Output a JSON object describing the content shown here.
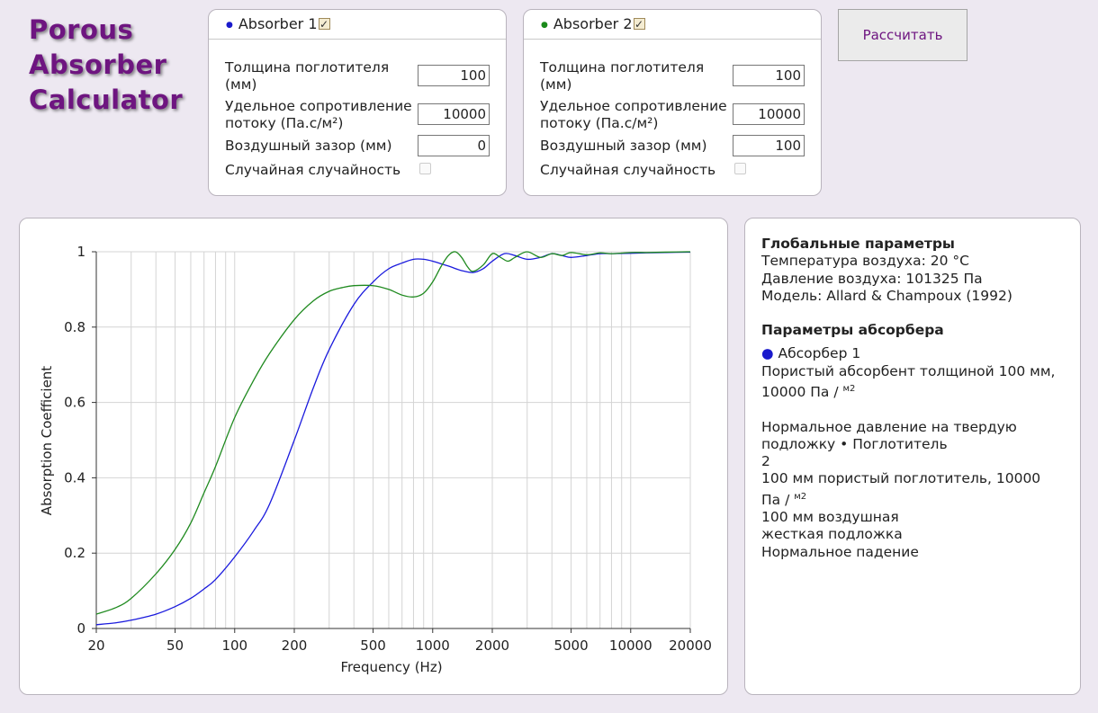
{
  "logo": {
    "line1": "Porous",
    "line2": "Absorber",
    "line3": "Calculator"
  },
  "absorbers": [
    {
      "title": "Absorber 1",
      "enabled": true,
      "dot_color": "#1a1acc",
      "fields": {
        "thickness_label_1": "Толщина поглотителя",
        "thickness_label_2": "(мм)",
        "thickness": "100",
        "resistivity_label_1": "Удельное сопротивление",
        "resistivity_label_2": "потоку (Па.с/м²)",
        "resistivity": "10000",
        "airgap_label": "Воздушный зазор (мм)",
        "airgap": "0",
        "random_label": "Случайная случайность",
        "random": false
      }
    },
    {
      "title": "Absorber 2",
      "enabled": true,
      "dot_color": "#1a8a1a",
      "fields": {
        "thickness_label_1": "Толщина поглотителя",
        "thickness_label_2": "(мм)",
        "thickness": "100",
        "resistivity_label_1": "Удельное сопротивление",
        "resistivity_label_2": "потоку (Па.с/м²)",
        "resistivity": "10000",
        "airgap_label": "Воздушный зазор (мм)",
        "airgap": "100",
        "random_label": "Случайная случайность",
        "random": false
      }
    }
  ],
  "calculate_label": "Рассчитать",
  "chart_data": {
    "type": "line",
    "xlabel": "Frequency (Hz)",
    "ylabel": "Absorption Coefficient",
    "xscale": "log",
    "xlim": [
      20,
      20000
    ],
    "ylim": [
      0,
      1
    ],
    "xticks": [
      20,
      50,
      100,
      200,
      500,
      1000,
      2000,
      5000,
      10000,
      20000
    ],
    "xtick_labels": [
      "20",
      "50",
      "100",
      "200",
      "500",
      "1000",
      "2000",
      "5000",
      "10000",
      "20000"
    ],
    "yticks": [
      0,
      0.2,
      0.4,
      0.6,
      0.8,
      1
    ],
    "ytick_labels": [
      "0",
      "0.2",
      "0.4",
      "0.6",
      "0.8",
      "1"
    ],
    "grid": true,
    "series": [
      {
        "color": "#1a1add",
        "x": [
          20,
          25,
          30,
          40,
          50,
          60,
          70,
          80,
          100,
          125,
          150,
          200,
          250,
          300,
          400,
          500,
          600,
          700,
          800,
          900,
          1000,
          1200,
          1400,
          1600,
          1800,
          2000,
          2300,
          2600,
          3000,
          3500,
          4000,
          4500,
          5000,
          6000,
          7000,
          8000,
          10000,
          12000,
          15000,
          20000
        ],
        "y": [
          0.01,
          0.015,
          0.022,
          0.038,
          0.058,
          0.08,
          0.105,
          0.13,
          0.19,
          0.26,
          0.33,
          0.5,
          0.64,
          0.74,
          0.86,
          0.92,
          0.955,
          0.97,
          0.98,
          0.98,
          0.975,
          0.962,
          0.95,
          0.945,
          0.955,
          0.975,
          0.995,
          0.99,
          0.98,
          0.985,
          0.995,
          0.99,
          0.985,
          0.99,
          0.995,
          0.995,
          0.996,
          0.997,
          0.998,
          0.999
        ]
      },
      {
        "color": "#1f8a1f",
        "x": [
          20,
          25,
          30,
          40,
          50,
          60,
          70,
          80,
          100,
          125,
          150,
          200,
          250,
          300,
          350,
          400,
          500,
          600,
          700,
          800,
          900,
          1000,
          1100,
          1200,
          1300,
          1400,
          1500,
          1600,
          1800,
          2000,
          2200,
          2400,
          2600,
          3000,
          3500,
          4000,
          4500,
          5000,
          6000,
          7000,
          8000,
          10000,
          12000,
          15000,
          20000
        ],
        "y": [
          0.038,
          0.055,
          0.08,
          0.145,
          0.21,
          0.28,
          0.36,
          0.43,
          0.56,
          0.66,
          0.73,
          0.82,
          0.87,
          0.895,
          0.905,
          0.91,
          0.91,
          0.9,
          0.885,
          0.88,
          0.89,
          0.92,
          0.96,
          0.99,
          1.0,
          0.985,
          0.96,
          0.948,
          0.965,
          0.995,
          0.985,
          0.975,
          0.985,
          1.0,
          0.985,
          0.995,
          0.99,
          0.998,
          0.992,
          0.997,
          0.995,
          0.998,
          0.998,
          0.999,
          1.0
        ]
      }
    ]
  },
  "info": {
    "global_title": "Глобальные параметры",
    "temperature": "Температура воздуха: 20 °C",
    "pressure": "Давление воздуха: 101325 Па",
    "model": "Модель: Allard & Champoux (1992)",
    "absorber_params_title": "Параметры абсорбера",
    "abs1_bullet": "●",
    "abs1_name": "Абсорбер 1",
    "abs1_line1": "Пористый абсорбент толщиной 100 мм,",
    "abs1_line2": "10000 Па /",
    "abs1_unit": "м2",
    "abs1_line3": "Нормальное давление на твердую",
    "abs1_line4": "подложку • Поглотитель",
    "abs2_line1": "2",
    "abs2_line2": "100 мм пористый поглотитель, 10000",
    "abs2_line3": "Па /",
    "abs2_unit": "м2",
    "abs2_line4": "100 мм воздушная",
    "abs2_line5": "жесткая подложка",
    "abs2_line6": "Нормальное падение"
  }
}
